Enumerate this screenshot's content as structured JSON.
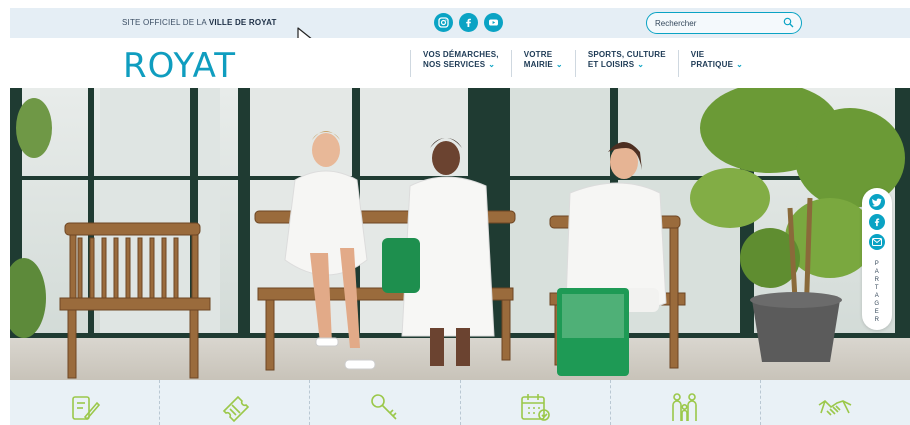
{
  "topbar": {
    "site_prefix": "SITE OFFICIEL DE LA",
    "site_name": "VILLE DE ROYAT",
    "socials": [
      "instagram-icon",
      "facebook-icon",
      "youtube-icon"
    ],
    "search_placeholder": "Rechercher"
  },
  "header": {
    "logo": "ROYAT",
    "nav": [
      {
        "line1": "VOS DÉMARCHES,",
        "line2": "NOS SERVICES"
      },
      {
        "line1": "VOTRE",
        "line2": "MAIRIE"
      },
      {
        "line1": "SPORTS, CULTURE",
        "line2": "ET LOISIRS"
      },
      {
        "line1": "VIE",
        "line2": "PRATIQUE"
      }
    ]
  },
  "share": {
    "label": "PARTAGER",
    "buttons": [
      "twitter-icon",
      "facebook-icon",
      "email-icon"
    ]
  },
  "quick_links": [
    "form-pencil-icon",
    "ticket-icon",
    "key-icon",
    "calendar-icon",
    "family-icon",
    "handshake-icon"
  ],
  "colors": {
    "accent": "#0aa3c4",
    "topbar_bg": "#e5eef5",
    "quick_bg": "#e9f1f6",
    "icon_green": "#9bc84a"
  }
}
